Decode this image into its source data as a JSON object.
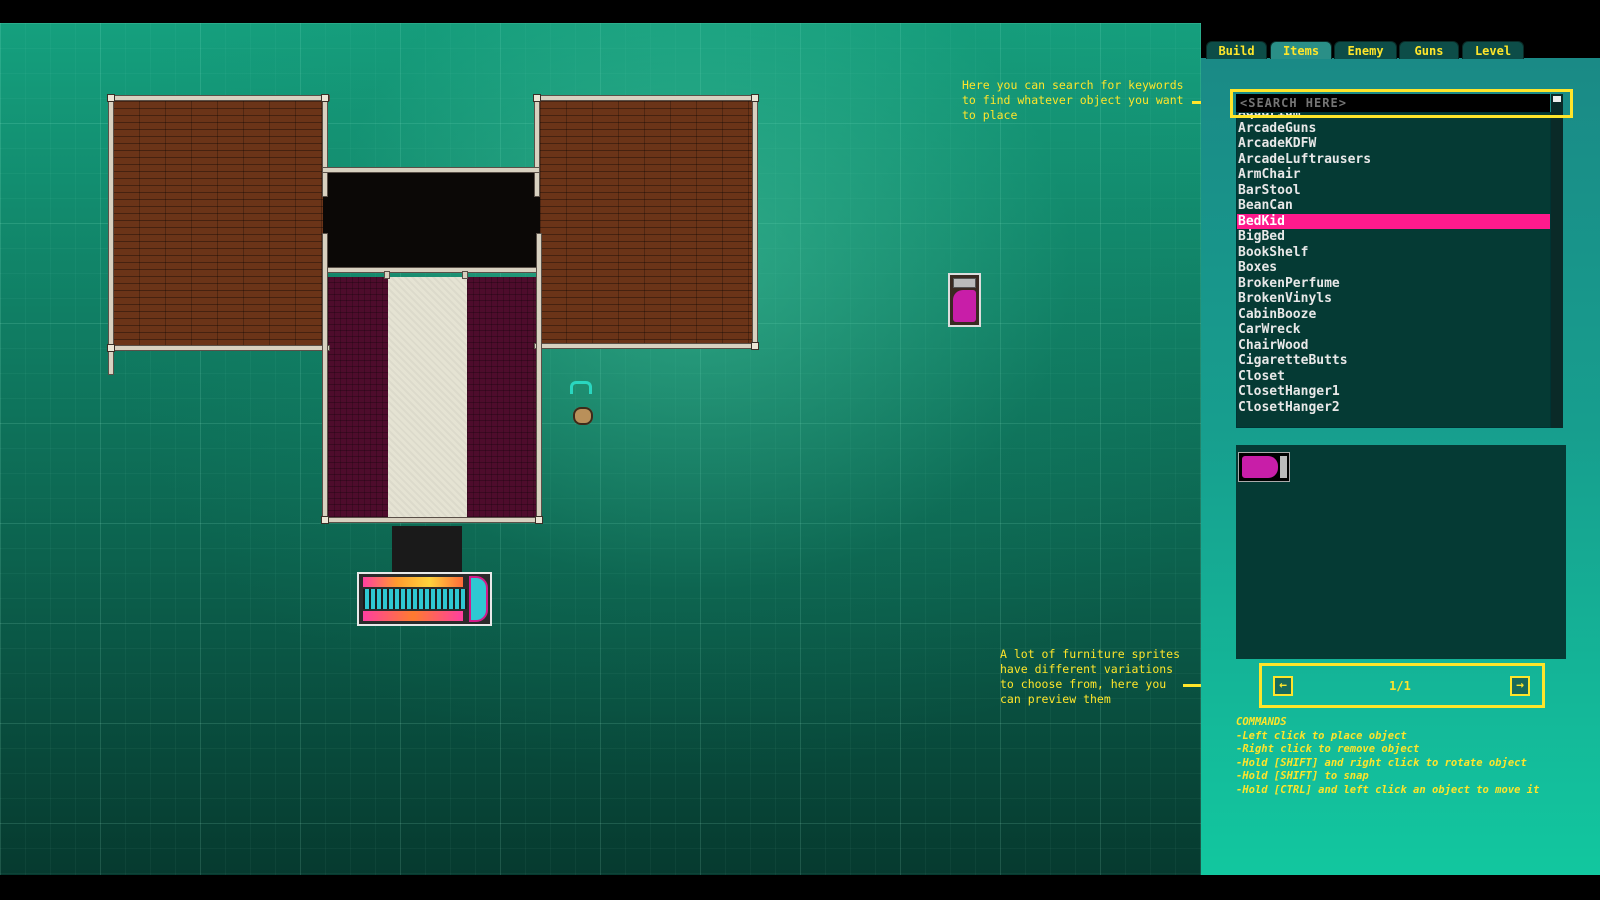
{
  "tabs": [
    {
      "label": "Build"
    },
    {
      "label": "Items"
    },
    {
      "label": "Enemy"
    },
    {
      "label": "Guns"
    },
    {
      "label": "Level"
    }
  ],
  "search": {
    "placeholder": "<SEARCH HERE>"
  },
  "items_list": [
    "Aquarium",
    "ArcadeGuns",
    "ArcadeKDFW",
    "ArcadeLuftrausers",
    "ArmChair",
    "BarStool",
    "BeanCan",
    "BedKid",
    "BigBed",
    "BookShelf",
    "Boxes",
    "BrokenPerfume",
    "BrokenVinyls",
    "CabinBooze",
    "CarWreck",
    "ChairWood",
    "CigaretteButts",
    "Closet",
    "ClosetHanger1",
    "ClosetHanger2"
  ],
  "selected_item": "BedKid",
  "pager": {
    "prev_icon": "arrow-left-icon",
    "next_icon": "arrow-right-icon",
    "text": "1/1"
  },
  "annotations": {
    "search_help": [
      "Here you can search for keywords",
      "to find whatever object you want",
      "to place"
    ],
    "variations_help": [
      "A lot of furniture sprites",
      "have different variations",
      "to choose from, here you",
      "can preview them"
    ]
  },
  "commands": {
    "title": "COMMANDS",
    "lines": [
      "-Left click to place object",
      "-Right click to remove object",
      "-Hold [SHIFT] and right click to rotate object",
      "-Hold [SHIFT] to snap",
      "-Hold [CTRL] and left click an object to move it"
    ]
  },
  "colors": {
    "accent": "#ffe52a",
    "selection": "#ff1a8c",
    "panel": "#179e8e"
  }
}
